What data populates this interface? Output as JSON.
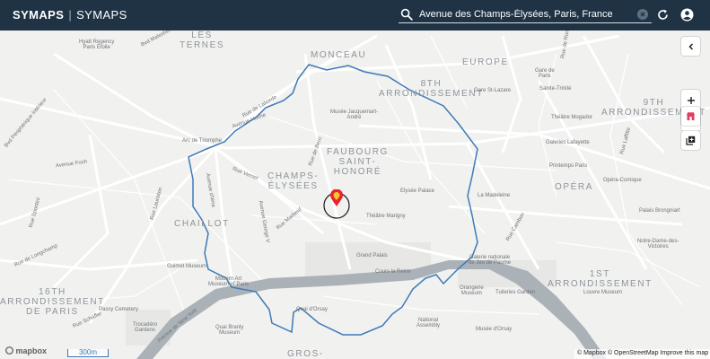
{
  "header": {
    "brand_primary": "SYMAPS",
    "brand_separator": "|",
    "brand_secondary": "SYMAPS",
    "search_value": "Avenue des Champs-Élysées, Paris, France"
  },
  "map": {
    "districts": [
      {
        "id": "ternes",
        "text": "LES\nTERNES"
      },
      {
        "id": "monceau",
        "text": "MONCEAU"
      },
      {
        "id": "europe",
        "text": "EUROPE"
      },
      {
        "id": "8th",
        "text": "8TH\nARRONDISSEMENT"
      },
      {
        "id": "9th",
        "text": "9TH\nARRONDISSEMENT"
      },
      {
        "id": "faubourg",
        "text": "FAUBOURG\nSAINT-\nHONORÉ"
      },
      {
        "id": "champs",
        "text": "CHAMPS-\nÉLYSÉES"
      },
      {
        "id": "opera",
        "text": "OPÉRA"
      },
      {
        "id": "chaillot",
        "text": "CHAILLOT"
      },
      {
        "id": "16th",
        "text": "16TH\nARRONDISSEMENT\nDE PARIS"
      },
      {
        "id": "1st",
        "text": "1ST\nARRONDISSEMENT"
      },
      {
        "id": "gros",
        "text": "GROS-"
      }
    ],
    "streets": [
      {
        "id": "bvd-malesherbes",
        "text": "Bvd Malesherbes"
      },
      {
        "id": "rue-de-rome",
        "text": "Rue de Rome"
      },
      {
        "id": "rue-lamarck",
        "text": "Rue de Laborde"
      },
      {
        "id": "avenue-foch",
        "text": "Avenue Foch"
      },
      {
        "id": "rue-de-berri",
        "text": "Rue de Berri"
      },
      {
        "id": "rue-vernet",
        "text": "Rue Vernet"
      },
      {
        "id": "av-iena",
        "text": "Avenue d'Iéna"
      },
      {
        "id": "av-george",
        "text": "Avenue George V"
      },
      {
        "id": "rue-marbeuf",
        "text": "Rue Marbeuf"
      },
      {
        "id": "rue-lauriston",
        "text": "Rue Lauriston"
      },
      {
        "id": "rue-spontini",
        "text": "Rue Spontini"
      },
      {
        "id": "rue-longchamp",
        "text": "Rue de Longchamp"
      },
      {
        "id": "av-hoche",
        "text": "Avenue Hoche"
      },
      {
        "id": "bvd-peripherique",
        "text": "Bvd Périphérique Intérieur"
      },
      {
        "id": "av-new-york",
        "text": "Avenue de New York"
      },
      {
        "id": "quai-orsay",
        "text": "Quai d'Orsay"
      },
      {
        "id": "cours-reine",
        "text": "Cours la Reine"
      },
      {
        "id": "rue-schaffer",
        "text": "Rue Schaffer"
      },
      {
        "id": "rue-cambon",
        "text": "Rue Cambon"
      },
      {
        "id": "rue-laffitte",
        "text": "Rue Laffitte"
      }
    ],
    "places": [
      {
        "id": "hyatt",
        "text": "Hyatt Regency\nParis Étoile"
      },
      {
        "id": "gare-st-lazare",
        "text": "Gare St-Lazare"
      },
      {
        "id": "gare-lazare-line",
        "text": "Gare de\nParis"
      },
      {
        "id": "saint-trinite",
        "text": "Sainte-Trinité"
      },
      {
        "id": "theatre-mogador",
        "text": "Théâtre Mogador"
      },
      {
        "id": "musee-jacquemart",
        "text": "Musée Jacquemart-\nAndré"
      },
      {
        "id": "arc",
        "text": "Arc de Triomphe"
      },
      {
        "id": "galeries",
        "text": "Galeries Lafayette"
      },
      {
        "id": "printemps",
        "text": "Printemps Paris"
      },
      {
        "id": "elysee",
        "text": "Elysée Palace"
      },
      {
        "id": "madeleine",
        "text": "La Madeleine"
      },
      {
        "id": "opera-comique",
        "text": "Opéra-Comique"
      },
      {
        "id": "theatre-marigny",
        "text": "Théâtre Marigny"
      },
      {
        "id": "palais-brongniart",
        "text": "Palais Brongniart"
      },
      {
        "id": "notre-dame-victoires",
        "text": "Notre-Dame-des-\nVictoires"
      },
      {
        "id": "grand-palais",
        "text": "Grand Palais"
      },
      {
        "id": "galerie-jeu-paume",
        "text": "Galerie nationale\nde Jeu de Paume"
      },
      {
        "id": "guimet",
        "text": "Guimet Museum"
      },
      {
        "id": "modern-art",
        "text": "Modern Art\nMuseum of Paris"
      },
      {
        "id": "orangerie",
        "text": "Orangerie\nMuseum"
      },
      {
        "id": "tuileries",
        "text": "Tuileries Garden"
      },
      {
        "id": "louvre",
        "text": "Louvre Museum"
      },
      {
        "id": "trocadero",
        "text": "Trocadéro\nGardens"
      },
      {
        "id": "paris-cemetery",
        "text": "Passy Cemetery"
      },
      {
        "id": "branly",
        "text": "Quai Branly\nMuseum"
      },
      {
        "id": "national-assembly",
        "text": "National\nAssembly"
      },
      {
        "id": "orsay",
        "text": "Musée d'Orsay"
      }
    ],
    "scale_label": "300m",
    "logo_text": "mapbox",
    "attribution": "© Mapbox © OpenStreetMap Improve this map"
  },
  "colors": {
    "topbar": "#1f3345",
    "boundary": "#3d7ab8",
    "river": "#aab2b8",
    "marker": "#e6262c"
  }
}
